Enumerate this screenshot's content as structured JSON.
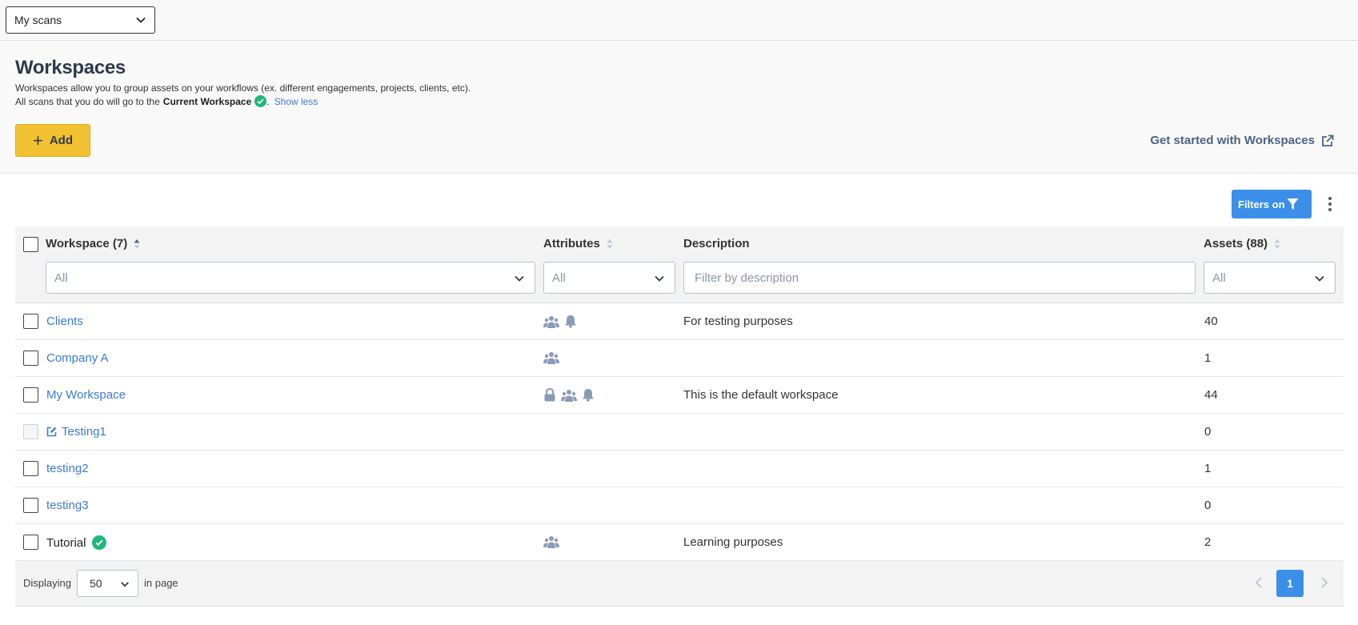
{
  "scan_selector": {
    "value": "My scans"
  },
  "header": {
    "title": "Workspaces",
    "description_line1": "Workspaces allow you to group assets on your workflows (ex. different engagements, projects, clients, etc).",
    "description_line2_prefix": "All scans that you do will go to the",
    "description_line2_bold": "Current Workspace",
    "description_line2_suffix": ".",
    "show_less": "Show less",
    "add_label": "Add",
    "get_started_label": "Get started with Workspaces"
  },
  "toolbar": {
    "filters_label": "Filters on"
  },
  "table": {
    "columns": {
      "workspace": "Workspace (7)",
      "attributes": "Attributes",
      "description": "Description",
      "assets": "Assets (88)"
    },
    "filters": {
      "workspace": "All",
      "attributes": "All",
      "description_placeholder": "Filter by description",
      "assets": "All"
    },
    "rows": [
      {
        "name": "Clients",
        "attributes": [
          "team-icon",
          "bell-icon"
        ],
        "description": "For testing purposes",
        "assets": "40"
      },
      {
        "name": "Company A",
        "attributes": [
          "team-icon"
        ],
        "description": "",
        "assets": "1"
      },
      {
        "name": "My Workspace",
        "attributes": [
          "lock-icon",
          "team-icon",
          "bell-icon"
        ],
        "description": "This is the default workspace",
        "assets": "44"
      },
      {
        "name": "Testing1",
        "attributes": [],
        "description": "",
        "assets": "0",
        "editable_icon": "edit-icon",
        "checkbox_disabled": true
      },
      {
        "name": "testing2",
        "attributes": [],
        "description": "",
        "assets": "1"
      },
      {
        "name": "testing3",
        "attributes": [],
        "description": "",
        "assets": "0"
      },
      {
        "name": "Tutorial",
        "attributes": [
          "team-icon"
        ],
        "description": "Learning purposes",
        "assets": "2",
        "current": true
      }
    ]
  },
  "pagination": {
    "displaying_label": "Displaying",
    "page_size": "50",
    "in_page_label": "in page",
    "current_page": "1"
  },
  "colors": {
    "accent_yellow": "#f2c131",
    "primary_blue": "#3b8fe8",
    "link_blue": "#3a7bd5",
    "success_green": "#1db87a",
    "icon_gray": "#8a9bb5"
  }
}
